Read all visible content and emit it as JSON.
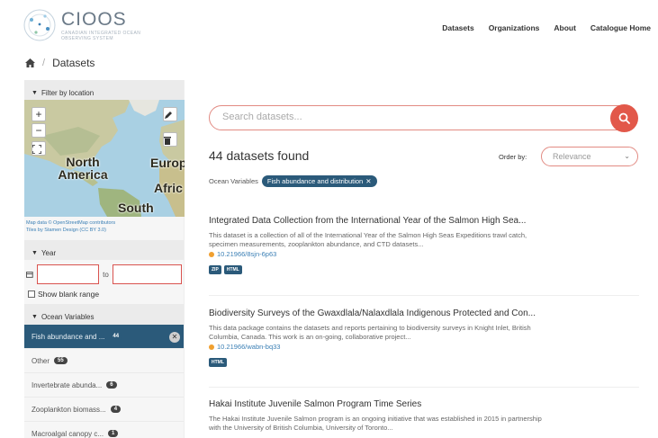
{
  "header": {
    "logo_title": "CIOOS",
    "logo_subtitle": "CANADIAN INTEGRATED OCEAN OBSERVING SYSTEM",
    "nav": [
      "Datasets",
      "Organizations",
      "About",
      "Catalogue Home"
    ]
  },
  "breadcrumb": {
    "home_icon": "home-icon",
    "current": "Datasets"
  },
  "sidebar": {
    "filter_location_label": "Filter by location",
    "map": {
      "labels": [
        "North America",
        "Europ",
        "Afric",
        "South"
      ],
      "zoom_in": "+",
      "zoom_out": "−",
      "attribution_line1": "Map data © OpenStreetMap contributors",
      "attribution_line2": "Tiles by Stamen Design (CC BY 3.0)"
    },
    "year_label": "Year",
    "year_to": "to",
    "show_blank_range": "Show blank range",
    "ocean_variables_label": "Ocean Variables",
    "variables": [
      {
        "label": "Fish abundance and ...",
        "count": "44",
        "active": true
      },
      {
        "label": "Other",
        "count": "55",
        "active": false
      },
      {
        "label": "Invertebrate abunda...",
        "count": "6",
        "active": false
      },
      {
        "label": "Zooplankton biomass...",
        "count": "4",
        "active": false
      },
      {
        "label": "Macroalgal canopy c...",
        "count": "1",
        "active": false
      }
    ]
  },
  "main": {
    "search_placeholder": "Search datasets...",
    "datasets_found": "44 datasets found",
    "order_by_label": "Order by:",
    "order_by_value": "Relevance",
    "active_filter_label": "Ocean Variables",
    "active_filter_value": "Fish abundance and distribution",
    "results": [
      {
        "title": "Integrated Data Collection from the International Year of the Salmon High Sea...",
        "desc_line1": "This dataset is a collection of all of the International Year of the Salmon High Seas Expeditions trawl catch,",
        "desc_line2": "specimen measurements, zooplankton abundance, and CTD datasets...",
        "doi": "10.21966/8sjn-6p63",
        "tags": [
          "ZIP",
          "HTML"
        ]
      },
      {
        "title": "Biodiversity Surveys of the Gwaxdlala/Nalaxdlala Indigenous Protected and Con...",
        "desc_line1": "This data package contains the datasets and reports pertaining to biodiversity surveys in Knight Inlet, British",
        "desc_line2": "Columbia, Canada. This work is an on-going, collaborative project...",
        "doi": "10.21966/wabn-bq33",
        "tags": [
          "HTML"
        ]
      },
      {
        "title": "Hakai Institute Juvenile Salmon Program Time Series",
        "desc_line1": "The Hakai Institute Juvenile Salmon program is an ongoing initiative that was established in 2015 in partnership",
        "desc_line2": "with the University of British Columbia, University of Toronto...",
        "doi": "",
        "tags": []
      }
    ]
  },
  "colors": {
    "accent_red": "#e2584a",
    "primary_blue": "#2b5a7a",
    "link_blue": "#3a7fb5"
  }
}
